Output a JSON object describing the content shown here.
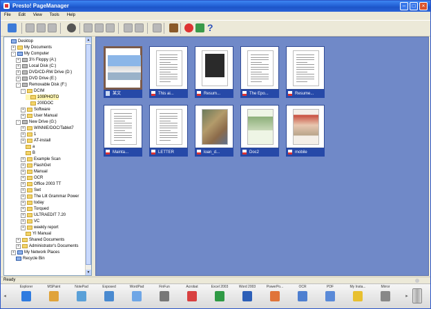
{
  "window": {
    "title": "Presto! PageManager"
  },
  "menu": [
    "File",
    "Edit",
    "View",
    "Tools",
    "Help"
  ],
  "tree": [
    {
      "label": "Desktop",
      "d": 0,
      "icon": "pc",
      "pm": ""
    },
    {
      "label": "My Documents",
      "d": 1,
      "icon": "folder",
      "pm": "+"
    },
    {
      "label": "My Computer",
      "d": 1,
      "icon": "pc",
      "pm": "-"
    },
    {
      "label": "3½ Floppy (A:)",
      "d": 2,
      "icon": "drive",
      "pm": "+"
    },
    {
      "label": "Local Disk (C:)",
      "d": 2,
      "icon": "drive",
      "pm": "+"
    },
    {
      "label": "DVD/CD-RW Drive (D:)",
      "d": 2,
      "icon": "drive",
      "pm": "+"
    },
    {
      "label": "DVD Drive (E:)",
      "d": 2,
      "icon": "drive",
      "pm": "+"
    },
    {
      "label": "Removable Disk (F:)",
      "d": 2,
      "icon": "drive",
      "pm": "-"
    },
    {
      "label": "DCIM",
      "d": 3,
      "icon": "folder",
      "pm": "-"
    },
    {
      "label": "100PHOTO",
      "d": 4,
      "icon": "folder",
      "pm": "",
      "selected": true
    },
    {
      "label": "200DOC",
      "d": 4,
      "icon": "folder",
      "pm": ""
    },
    {
      "label": "Software",
      "d": 3,
      "icon": "folder",
      "pm": "+"
    },
    {
      "label": "User Manual",
      "d": 3,
      "icon": "folder",
      "pm": "+"
    },
    {
      "label": "New Drive (G:)",
      "d": 2,
      "icon": "drive",
      "pm": "-"
    },
    {
      "label": "WINNIE/DOC/Tablet7",
      "d": 3,
      "icon": "folder",
      "pm": "+"
    },
    {
      "label": "1",
      "d": 3,
      "icon": "folder",
      "pm": "+"
    },
    {
      "label": "AT-install",
      "d": 3,
      "icon": "folder",
      "pm": "+"
    },
    {
      "label": "a",
      "d": 3,
      "icon": "folder",
      "pm": ""
    },
    {
      "label": "B",
      "d": 3,
      "icon": "folder",
      "pm": ""
    },
    {
      "label": "Example Scan",
      "d": 3,
      "icon": "folder",
      "pm": "+"
    },
    {
      "label": "FlashGet",
      "d": 3,
      "icon": "folder",
      "pm": "+"
    },
    {
      "label": "Manual",
      "d": 3,
      "icon": "folder",
      "pm": "+"
    },
    {
      "label": "OCR",
      "d": 3,
      "icon": "folder",
      "pm": "+"
    },
    {
      "label": "Office 2003 TT",
      "d": 3,
      "icon": "folder",
      "pm": "+"
    },
    {
      "label": "Swt",
      "d": 3,
      "icon": "folder",
      "pm": "+"
    },
    {
      "label": "The Lilt Grammar Power",
      "d": 3,
      "icon": "folder",
      "pm": "+"
    },
    {
      "label": "today",
      "d": 3,
      "icon": "folder",
      "pm": "+"
    },
    {
      "label": "Torqued",
      "d": 3,
      "icon": "folder",
      "pm": "+"
    },
    {
      "label": "ULTRAEDIT 7.20",
      "d": 3,
      "icon": "folder",
      "pm": "+"
    },
    {
      "label": "VC",
      "d": 3,
      "icon": "folder",
      "pm": "+"
    },
    {
      "label": "weekly report",
      "d": 3,
      "icon": "folder",
      "pm": "+"
    },
    {
      "label": "YI Manual",
      "d": 3,
      "icon": "folder",
      "pm": ""
    },
    {
      "label": "Shared Documents",
      "d": 2,
      "icon": "folder",
      "pm": "+"
    },
    {
      "label": "Administrator's Documents",
      "d": 2,
      "icon": "folder",
      "pm": "+"
    },
    {
      "label": "My Network Places",
      "d": 1,
      "icon": "pc",
      "pm": "+"
    },
    {
      "label": "Recycle Bin",
      "d": 1,
      "icon": "pc",
      "pm": ""
    }
  ],
  "files": [
    {
      "name": "某文",
      "type": "img",
      "art": "photo-sky",
      "selected": true
    },
    {
      "name": "This ai...",
      "type": "pdf",
      "art": "doc"
    },
    {
      "name": "Resum...",
      "type": "pdf",
      "art": "dark"
    },
    {
      "name": "The Epo...",
      "type": "pdf",
      "art": "doc"
    },
    {
      "name": "Resume...",
      "type": "pdf",
      "art": "doc"
    },
    {
      "name": "Mainta...",
      "type": "pdf",
      "art": "doc"
    },
    {
      "name": "LETTER",
      "type": "pdf",
      "art": "doc"
    },
    {
      "name": "loan_d...",
      "type": "pdf",
      "art": "photo-color"
    },
    {
      "name": "Doc2",
      "type": "pdf",
      "art": "photo-green"
    },
    {
      "name": "mobile",
      "type": "pdf",
      "art": "photo-red"
    }
  ],
  "status": "Ready",
  "apps": [
    {
      "label": "Explorer",
      "icon": "explorer-icon",
      "color": "#2f7be0"
    },
    {
      "label": "MSPaint",
      "icon": "paint-icon",
      "color": "#e0a33a"
    },
    {
      "label": "NotePad",
      "icon": "notepad-icon",
      "color": "#5aa0d8"
    },
    {
      "label": "Exposed",
      "icon": "exposed-icon",
      "color": "#4a8ad0"
    },
    {
      "label": "WordPad",
      "icon": "wordpad-icon",
      "color": "#6fa6e6"
    },
    {
      "label": "FinFun",
      "icon": "printer-icon",
      "color": "#777777"
    },
    {
      "label": "Acrobat",
      "icon": "acrobat-icon",
      "color": "#d84040"
    },
    {
      "label": "Excel 2003",
      "icon": "excel-icon",
      "color": "#2f9a45"
    },
    {
      "label": "Word 2003",
      "icon": "word-icon",
      "color": "#2d5fb8"
    },
    {
      "label": "PowerPo...",
      "icon": "powerpoint-icon",
      "color": "#e0743a"
    },
    {
      "label": "OCR",
      "icon": "ocr-icon",
      "color": "#4e7fd0"
    },
    {
      "label": "PDF",
      "icon": "pdf-icon",
      "color": "#5a8ad8"
    },
    {
      "label": "My Insta...",
      "icon": "help-icon",
      "color": "#e8c030"
    },
    {
      "label": "Mirror",
      "icon": "mirror-icon",
      "color": "#888888"
    }
  ]
}
